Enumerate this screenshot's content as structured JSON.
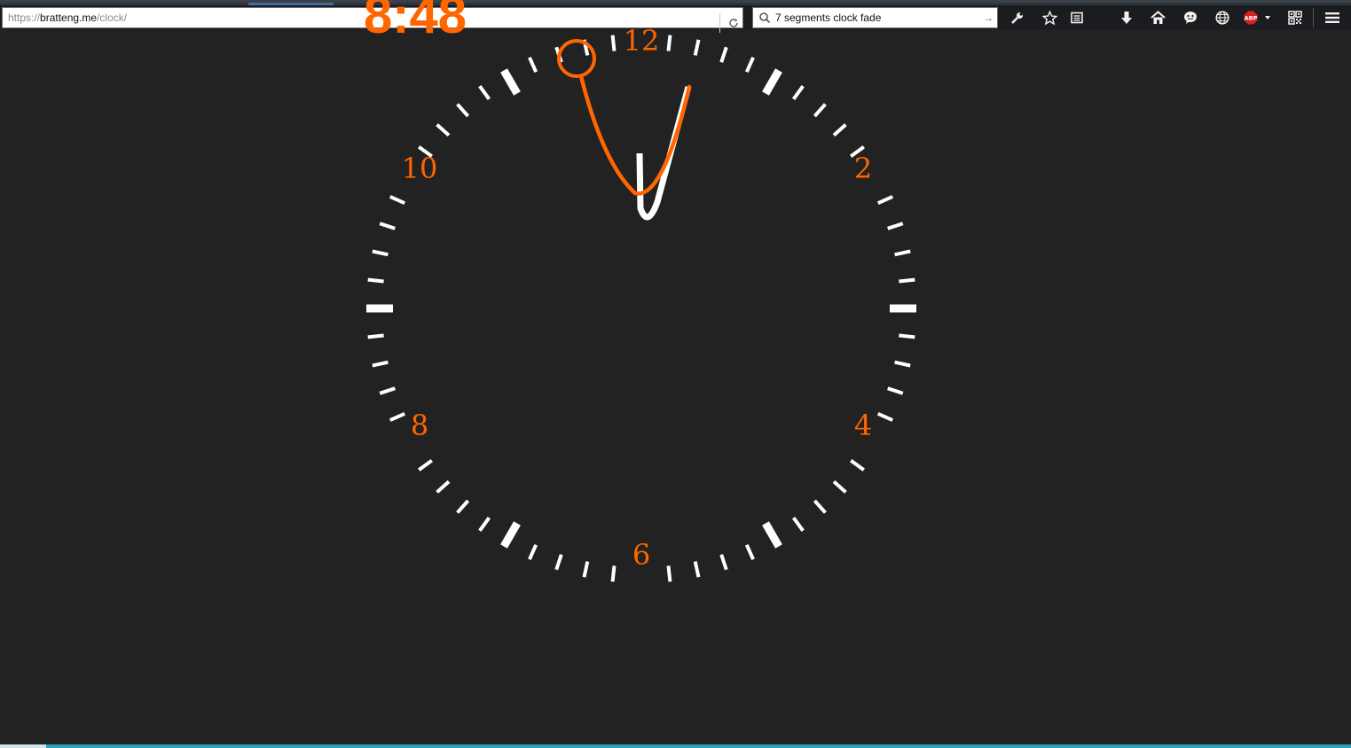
{
  "browser": {
    "url": {
      "scheme": "https://",
      "host": "bratteng.me",
      "path": "/clock/"
    },
    "search": {
      "value": "7 segments clock fade"
    },
    "toolbar_icons": [
      "wrench-icon",
      "star-icon",
      "reader-icon",
      "download-icon",
      "home-icon",
      "chat-icon",
      "globe-icon",
      "adblock-icon",
      "qr-icon",
      "menu-icon"
    ],
    "adblock_label": "ABP"
  },
  "clock": {
    "numerals": [
      "12",
      "2",
      "4",
      "6",
      "8",
      "10"
    ],
    "partial_digital_text": "8:48",
    "tick_color": "#ffffff",
    "numeral_color": "#ff6600",
    "background_color": "#222222",
    "hour_hand_color": "#ffffff",
    "minute_hand_color": "#ff6600"
  }
}
